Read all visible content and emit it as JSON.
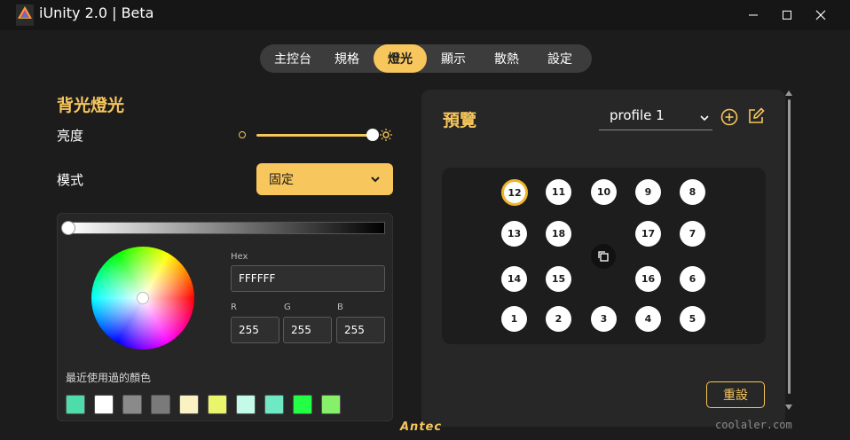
{
  "window": {
    "title": "iUnity 2.0 | Beta"
  },
  "tabs": [
    {
      "label": "主控台",
      "active": false
    },
    {
      "label": "規格",
      "active": false
    },
    {
      "label": "燈光",
      "active": true
    },
    {
      "label": "顯示",
      "active": false
    },
    {
      "label": "散熱",
      "active": false
    },
    {
      "label": "設定",
      "active": false
    }
  ],
  "backlight": {
    "title": "背光燈光",
    "brightness_label": "亮度",
    "brightness_level": 1.0,
    "mode_label": "模式",
    "mode_value": "固定"
  },
  "color_picker": {
    "hex_label": "Hex",
    "hex_value": "FFFFFF",
    "r_label": "R",
    "r_value": "255",
    "g_label": "G",
    "g_value": "255",
    "b_label": "B",
    "b_value": "255",
    "recent_label": "最近使用過的顏色",
    "recent_colors": [
      "#4ddcaa",
      "#ffffff",
      "#8a8a8a",
      "#7a7a7a",
      "#fbf2c4",
      "#e9f56a",
      "#c3fbe8",
      "#6ee9c4",
      "#22ff44",
      "#86f06a"
    ]
  },
  "preview": {
    "title": "預覽",
    "profile_value": "profile 1",
    "reset_label": "重設",
    "selected_fan": "12",
    "fans_rows": [
      [
        "12",
        "11",
        "10",
        "9",
        "8"
      ],
      [
        "13",
        "18",
        "",
        "17",
        "7"
      ],
      [
        "14",
        "15",
        "",
        "16",
        "6"
      ],
      [
        "1",
        "2",
        "3",
        "4",
        "5"
      ]
    ]
  },
  "footer": {
    "brand": "Antec",
    "watermark": "coolaler.com"
  },
  "colors": {
    "accent": "#f7c65c",
    "background": "#1c1c1c",
    "card": "#272727"
  }
}
